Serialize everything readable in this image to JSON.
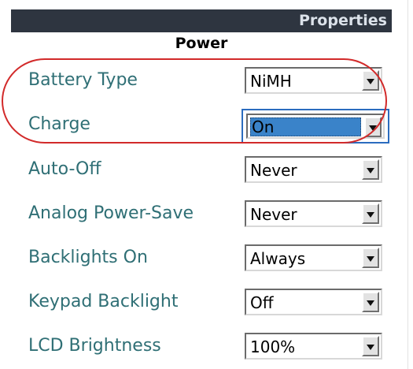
{
  "panel": {
    "title": "Properties",
    "section": "Power"
  },
  "settings": [
    {
      "label": "Battery Type",
      "value": "NiMH"
    },
    {
      "label": "Charge",
      "value": "On"
    },
    {
      "label": "Auto-Off",
      "value": "Never"
    },
    {
      "label": "Analog Power-Save",
      "value": "Never"
    },
    {
      "label": "Backlights On",
      "value": "Always"
    },
    {
      "label": "Keypad Backlight",
      "value": "Off"
    },
    {
      "label": "LCD Brightness",
      "value": "100%"
    }
  ],
  "icons": {
    "dropdown": "chevron-down-icon"
  },
  "colors": {
    "header_bg": "#2e3540",
    "label_text": "#2f6f75",
    "focus_border": "#2b6cbf",
    "selection_bg": "#3a83c9",
    "annotation_ring": "#d22a2a"
  }
}
